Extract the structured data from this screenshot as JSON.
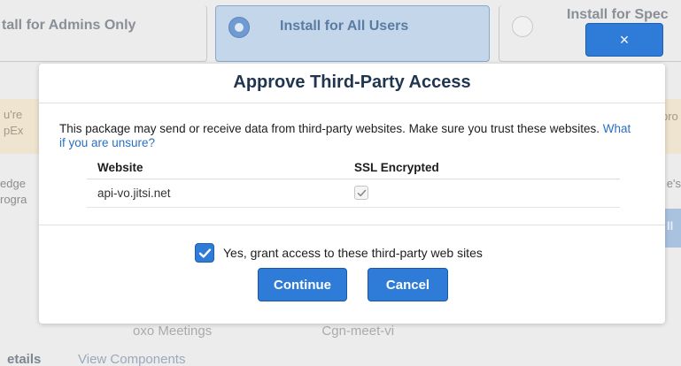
{
  "background": {
    "options": [
      {
        "label": "tall for Admins Only"
      },
      {
        "label": "Install for All Users"
      },
      {
        "label": "Install for Spec"
      }
    ],
    "left_fragments": [
      "u're",
      "pEx"
    ],
    "right_fragment_top": "pro",
    "left_fragments_lower": [
      "edge",
      "rogra"
    ],
    "right_fragment_lower": "e's",
    "right_button_fragment": "ll",
    "row_fragment_left": "oxo Meetings",
    "row_fragment_mid": "Cgn-meet-vi",
    "tabs": {
      "details": "etails",
      "components": "View Components"
    }
  },
  "close_button": {
    "label": "×"
  },
  "modal": {
    "title": "Approve Third-Party Access",
    "description": "This package may send or receive data from third-party websites. Make sure you trust these websites.",
    "help_link": "What if you are unsure?",
    "table": {
      "columns": [
        "Website",
        "SSL Encrypted"
      ],
      "rows": [
        {
          "website": "api-vo.jitsi.net",
          "ssl_encrypted": true
        }
      ]
    },
    "grant_checkbox": {
      "label": "Yes, grant access to these third-party web sites",
      "checked": true
    },
    "buttons": {
      "continue": "Continue",
      "cancel": "Cancel"
    }
  },
  "colors": {
    "accent": "#2f7bd8",
    "title": "#1f3550",
    "link": "#2a6fc4"
  }
}
